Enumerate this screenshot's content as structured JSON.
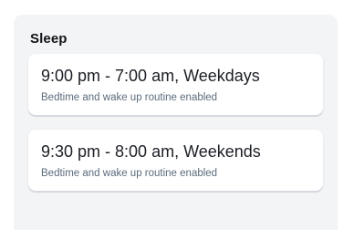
{
  "sleep": {
    "title": "Sleep",
    "schedules": [
      {
        "time": "9:00 pm - 7:00 am, Weekdays",
        "status": "Bedtime and wake up routine enabled"
      },
      {
        "time": "9:30 pm - 8:00 am, Weekends",
        "status": "Bedtime and wake up routine enabled"
      }
    ]
  }
}
